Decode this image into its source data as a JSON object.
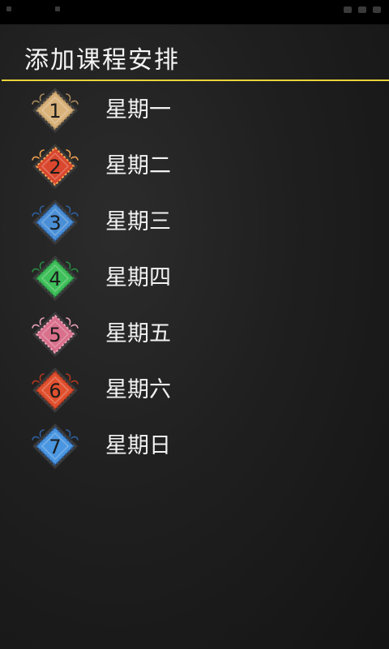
{
  "header": {
    "title": "添加课程安排",
    "divider_color": "#e8d33a"
  },
  "days": [
    {
      "number": "1",
      "label": "星期一",
      "badge_color": "#d9b27a",
      "accent_color": "#a98a5e"
    },
    {
      "number": "2",
      "label": "星期二",
      "badge_color": "#d9472e",
      "accent_color": "#f0a050"
    },
    {
      "number": "3",
      "label": "星期三",
      "badge_color": "#4a8fd6",
      "accent_color": "#2f5f9e"
    },
    {
      "number": "4",
      "label": "星期四",
      "badge_color": "#3fbf5a",
      "accent_color": "#2a8a42"
    },
    {
      "number": "5",
      "label": "星期五",
      "badge_color": "#d9708c",
      "accent_color": "#e8a0b8"
    },
    {
      "number": "6",
      "label": "星期六",
      "badge_color": "#e0502e",
      "accent_color": "#b03820"
    },
    {
      "number": "7",
      "label": "星期日",
      "badge_color": "#4a96e0",
      "accent_color": "#2f5f9e"
    }
  ]
}
